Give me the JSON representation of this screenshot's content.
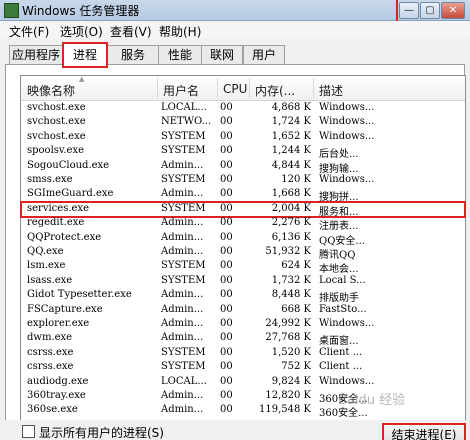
{
  "window": {
    "title": "Windows 任务管理器",
    "controls": [
      "—",
      "▢",
      "✕"
    ]
  },
  "menubar": {
    "items": [
      "文件(F)",
      "选项(O)",
      "查看(V)",
      "帮助(H)"
    ]
  },
  "tabs": [
    {
      "label": "应用程序",
      "active": false
    },
    {
      "label": "进程",
      "active": true
    },
    {
      "label": "服务",
      "active": false
    },
    {
      "label": "性能",
      "active": false
    },
    {
      "label": "联网",
      "active": false
    },
    {
      "label": "用户",
      "active": false
    }
  ],
  "columns": [
    "映像名称",
    "用户名",
    "CPU",
    "内存(...",
    "描述"
  ],
  "processes": [
    {
      "name": "svchost.exe",
      "user": "LOCAL...",
      "cpu": "00",
      "mem": "4,868 K",
      "desc": "Windows..."
    },
    {
      "name": "svchost.exe",
      "user": "NETWO...",
      "cpu": "00",
      "mem": "1,724 K",
      "desc": "Windows..."
    },
    {
      "name": "svchost.exe",
      "user": "SYSTEM",
      "cpu": "00",
      "mem": "1,652 K",
      "desc": "Windows..."
    },
    {
      "name": "spoolsv.exe",
      "user": "SYSTEM",
      "cpu": "00",
      "mem": "1,244 K",
      "desc": "后台处..."
    },
    {
      "name": "SogouCloud.exe",
      "user": "Admin...",
      "cpu": "00",
      "mem": "4,844 K",
      "desc": "搜狗输..."
    },
    {
      "name": "smss.exe",
      "user": "SYSTEM",
      "cpu": "00",
      "mem": "120 K",
      "desc": "Windows..."
    },
    {
      "name": "SGImeGuard.exe",
      "user": "Admin...",
      "cpu": "00",
      "mem": "1,668 K",
      "desc": "搜狗拼..."
    },
    {
      "name": "services.exe",
      "user": "SYSTEM",
      "cpu": "00",
      "mem": "2,004 K",
      "desc": "服务和...",
      "selected": true
    },
    {
      "name": "regedit.exe",
      "user": "Admin...",
      "cpu": "00",
      "mem": "2,276 K",
      "desc": "注册表..."
    },
    {
      "name": "QQProtect.exe",
      "user": "Admin...",
      "cpu": "00",
      "mem": "6,136 K",
      "desc": "QQ安全..."
    },
    {
      "name": "QQ.exe",
      "user": "Admin...",
      "cpu": "00",
      "mem": "51,932 K",
      "desc": "腾讯QQ"
    },
    {
      "name": "lsm.exe",
      "user": "SYSTEM",
      "cpu": "00",
      "mem": "624 K",
      "desc": "本地会..."
    },
    {
      "name": "lsass.exe",
      "user": "SYSTEM",
      "cpu": "00",
      "mem": "1,732 K",
      "desc": "Local S..."
    },
    {
      "name": "Gidot Typesetter.exe",
      "user": "Admin...",
      "cpu": "00",
      "mem": "8,448 K",
      "desc": "排版助手"
    },
    {
      "name": "FSCapture.exe",
      "user": "Admin...",
      "cpu": "00",
      "mem": "668 K",
      "desc": "FastSto..."
    },
    {
      "name": "explorer.exe",
      "user": "Admin...",
      "cpu": "00",
      "mem": "24,992 K",
      "desc": "Windows..."
    },
    {
      "name": "dwm.exe",
      "user": "Admin...",
      "cpu": "00",
      "mem": "27,768 K",
      "desc": "桌面窗..."
    },
    {
      "name": "csrss.exe",
      "user": "SYSTEM",
      "cpu": "00",
      "mem": "1,520 K",
      "desc": "Client ..."
    },
    {
      "name": "csrss.exe",
      "user": "SYSTEM",
      "cpu": "00",
      "mem": "752 K",
      "desc": "Client ..."
    },
    {
      "name": "audiodg.exe",
      "user": "LOCAL...",
      "cpu": "00",
      "mem": "9,824 K",
      "desc": "Windows..."
    },
    {
      "name": "360tray.exe",
      "user": "Admin...",
      "cpu": "00",
      "mem": "12,820 K",
      "desc": "360安全..."
    },
    {
      "name": "360se.exe",
      "user": "Admin...",
      "cpu": "00",
      "mem": "119,548 K",
      "desc": "360安全..."
    }
  ],
  "bottom": {
    "show_all_label": "显示所有用户的进程(S)",
    "end_process_label": "结束进程(E)"
  },
  "watermark": "Baidu 经验"
}
